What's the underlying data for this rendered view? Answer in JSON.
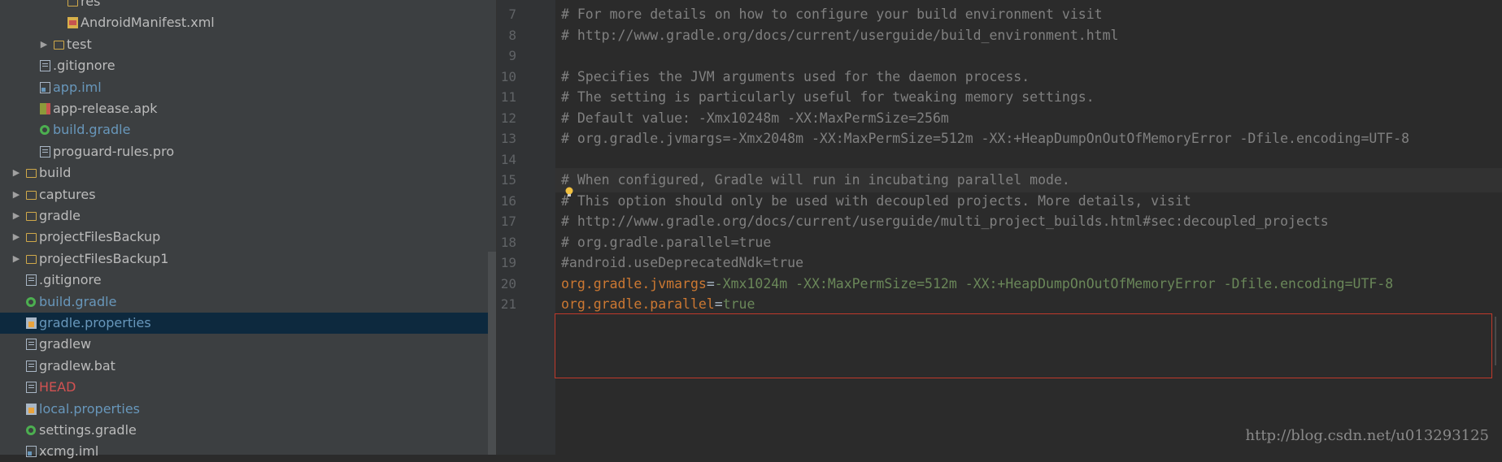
{
  "project_tree": [
    {
      "label": "res",
      "type": "folder",
      "indent": 3,
      "arrow": false,
      "color": "normal",
      "partial": true
    },
    {
      "label": "AndroidManifest.xml",
      "type": "xml",
      "indent": 3,
      "arrow": false,
      "color": "normal"
    },
    {
      "label": "test",
      "type": "folder",
      "indent": 2,
      "arrow": true,
      "color": "normal"
    },
    {
      "label": ".gitignore",
      "type": "file",
      "indent": 1,
      "arrow": false,
      "color": "normal"
    },
    {
      "label": "app.iml",
      "type": "iml",
      "indent": 1,
      "arrow": false,
      "color": "blue"
    },
    {
      "label": "app-release.apk",
      "type": "apk",
      "indent": 1,
      "arrow": false,
      "color": "normal"
    },
    {
      "label": "build.gradle",
      "type": "gradle",
      "indent": 1,
      "arrow": false,
      "color": "blue"
    },
    {
      "label": "proguard-rules.pro",
      "type": "file",
      "indent": 1,
      "arrow": false,
      "color": "normal"
    },
    {
      "label": "build",
      "type": "folder",
      "indent": 0,
      "arrow": true,
      "color": "normal"
    },
    {
      "label": "captures",
      "type": "folder",
      "indent": 0,
      "arrow": true,
      "color": "normal"
    },
    {
      "label": "gradle",
      "type": "folder",
      "indent": 0,
      "arrow": true,
      "color": "normal"
    },
    {
      "label": "projectFilesBackup",
      "type": "folder",
      "indent": 0,
      "arrow": true,
      "color": "normal"
    },
    {
      "label": "projectFilesBackup1",
      "type": "folder",
      "indent": 0,
      "arrow": true,
      "color": "normal"
    },
    {
      "label": ".gitignore",
      "type": "file",
      "indent": 0,
      "arrow": false,
      "color": "normal"
    },
    {
      "label": "build.gradle",
      "type": "gradle",
      "indent": 0,
      "arrow": false,
      "color": "blue"
    },
    {
      "label": "gradle.properties",
      "type": "props",
      "indent": 0,
      "arrow": false,
      "color": "blue",
      "selected": true
    },
    {
      "label": "gradlew",
      "type": "file",
      "indent": 0,
      "arrow": false,
      "color": "normal"
    },
    {
      "label": "gradlew.bat",
      "type": "file",
      "indent": 0,
      "arrow": false,
      "color": "normal"
    },
    {
      "label": "HEAD",
      "type": "file",
      "indent": 0,
      "arrow": false,
      "color": "red"
    },
    {
      "label": "local.properties",
      "type": "props",
      "indent": 0,
      "arrow": false,
      "color": "blue"
    },
    {
      "label": "settings.gradle",
      "type": "gradle",
      "indent": 0,
      "arrow": false,
      "color": "normal"
    },
    {
      "label": "xcmg.iml",
      "type": "iml",
      "indent": 0,
      "arrow": false,
      "color": "normal"
    }
  ],
  "editor": {
    "lines": [
      {
        "num": "7",
        "text": "# For more details on how to configure your build environment visit"
      },
      {
        "num": "8",
        "text": "# http://www.gradle.org/docs/current/userguide/build_environment.html"
      },
      {
        "num": "9",
        "text": ""
      },
      {
        "num": "10",
        "text": "# Specifies the JVM arguments used for the daemon process."
      },
      {
        "num": "11",
        "text": "# The setting is particularly useful for tweaking memory settings."
      },
      {
        "num": "12",
        "text": "# Default value: -Xmx10248m -XX:MaxPermSize=256m"
      },
      {
        "num": "13",
        "text": "# org.gradle.jvmargs=-Xmx2048m -XX:MaxPermSize=512m -XX:+HeapDumpOnOutOfMemoryError -Dfile.encoding=UTF-8"
      },
      {
        "num": "14",
        "text": ""
      },
      {
        "num": "15",
        "text": "# When configured, Gradle will run in incubating parallel mode.",
        "current": true
      },
      {
        "num": "16",
        "text": "# This option should only be used with decoupled projects. More details, visit"
      },
      {
        "num": "17",
        "text": "# http://www.gradle.org/docs/current/userguide/multi_project_builds.html#sec:decoupled_projects"
      },
      {
        "num": "18",
        "text": "# org.gradle.parallel=true"
      },
      {
        "num": "19",
        "text": "#android.useDeprecatedNdk=true"
      },
      {
        "num": "20",
        "key": "org.gradle.jvmargs",
        "eq": "=",
        "value": "-Xmx1024m -XX:MaxPermSize=512m -XX:+HeapDumpOnOutOfMemoryError -Dfile.encoding=UTF-8"
      },
      {
        "num": "21",
        "key": "org.gradle.parallel",
        "eq": "=",
        "value": "true"
      }
    ],
    "intention_icon": "lightbulb-icon"
  },
  "colors": {
    "comment": "#808080",
    "key": "#cc7832",
    "value": "#6a8759",
    "highlight_border": "#c0392b"
  },
  "watermark": "http://blog.csdn.net/u013293125"
}
